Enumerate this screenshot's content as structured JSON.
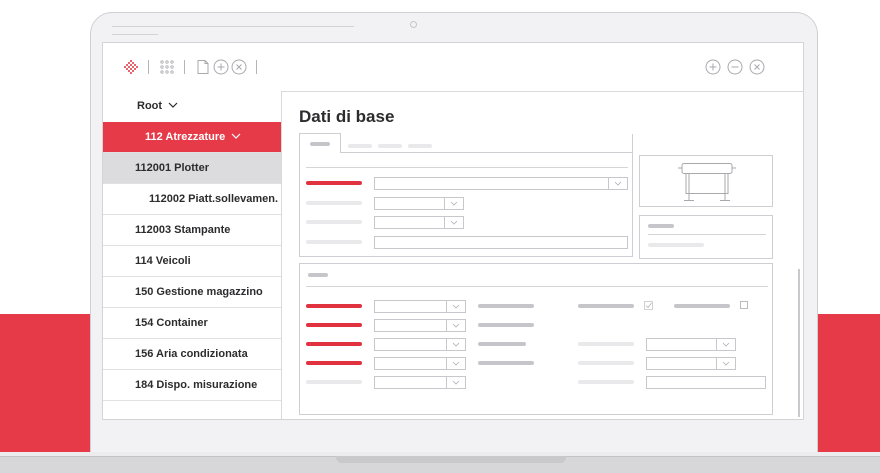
{
  "toolbar": {
    "left_icons": [
      "logo-icon",
      "apps-grid-icon",
      "document-icon",
      "plus-circle-icon",
      "close-circle-icon"
    ],
    "right_icons": [
      "plus-circle-icon",
      "minus-circle-icon",
      "close-circle-icon"
    ]
  },
  "sidebar": {
    "root_label": "Root",
    "items": [
      {
        "label": "112 Atrezzature",
        "state": "active"
      },
      {
        "label": "112001 Plotter",
        "state": "selected"
      },
      {
        "label": "112002 Piatt.sollevamen.",
        "state": "normal"
      },
      {
        "label": "112003 Stampante",
        "state": "normal"
      },
      {
        "label": "114 Veicoli",
        "state": "normal"
      },
      {
        "label": "150 Gestione magazzino",
        "state": "normal"
      },
      {
        "label": "154 Container",
        "state": "normal"
      },
      {
        "label": "156 Aria condizionata",
        "state": "normal"
      },
      {
        "label": "184 Dispo. misurazione",
        "state": "normal"
      }
    ]
  },
  "main": {
    "title": "Dati di base",
    "image_icon": "plotter-icon"
  },
  "colors": {
    "accent": "#e73a48",
    "selected_bg": "#dcdcdf",
    "text": "#2c2c2e",
    "border": "#cfcfd3"
  }
}
